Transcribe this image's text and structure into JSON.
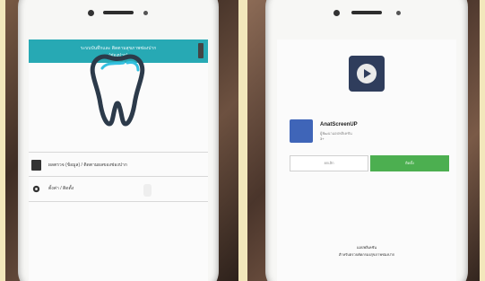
{
  "left_phone": {
    "header": {
      "title_line1": "ระบบบันทึกและ ติดตามสุขภาพช่องปาก",
      "title_line2": "(ช่องปาก)"
    },
    "logo_icon": "tooth-icon",
    "list": [
      {
        "icon": "account-icon",
        "label": "ผลตรวจ (ข้อมูล) / ติดตามผลของช่องปาก"
      },
      {
        "icon": "gear-icon",
        "label": "ตั้งค่า / ติดตั้ง"
      }
    ]
  },
  "right_phone": {
    "store_icon": "video-play-icon",
    "app": {
      "name": "AnatScreenUP",
      "developer": "ผู้พัฒนาแอปพลิเคชัน",
      "rating": "3+"
    },
    "buttons": {
      "cancel": "ยกเลิก",
      "install": "ติดตั้ง"
    },
    "footer": {
      "line1": "แอปพลิเคชัน",
      "line2": "สำหรับตรวจคัดกรองสุขภาพช่องปาก"
    }
  },
  "colors": {
    "header_teal": "#27a9b4",
    "install_green": "#4caf50",
    "app_icon_blue": "#3f65b8",
    "store_icon_navy": "#2f3d5c",
    "background_cream": "#efe3b5"
  }
}
